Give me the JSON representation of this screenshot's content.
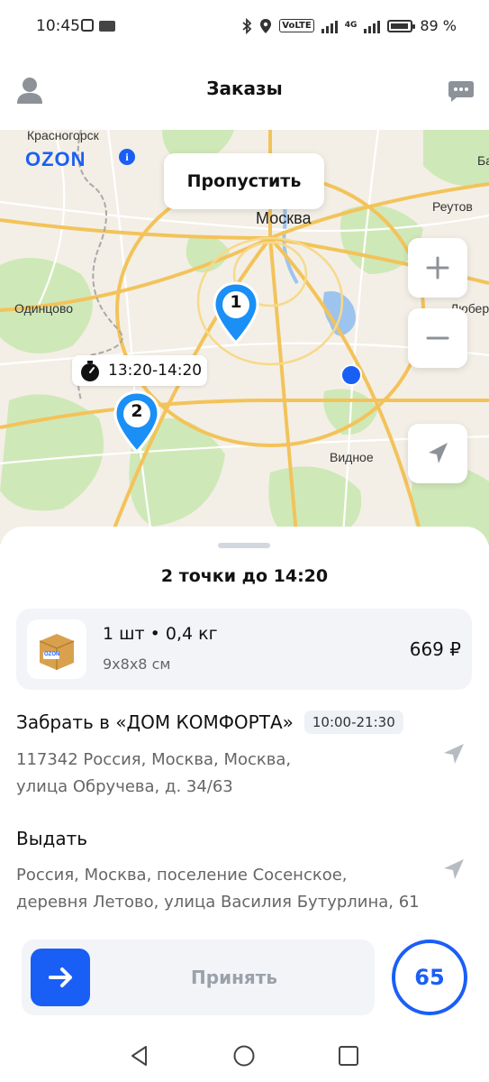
{
  "status_bar": {
    "time": "10:45",
    "network": "VoLTE",
    "signal_label": "4G",
    "battery_percent": "89 %"
  },
  "header": {
    "title": "Заказы"
  },
  "map": {
    "brand": "OZON",
    "skip_label": "Пропустить",
    "labels": {
      "krasnogorsk": "Красногорск",
      "moskva": "Москва",
      "reutov": "Реутов",
      "odintsovo": "Одинцово",
      "lyuber": "Люберц",
      "vidnoe": "Видное",
      "edge_b": "Ба"
    },
    "time_window": "13:20-14:20",
    "pins": [
      {
        "label": "1"
      },
      {
        "label": "2"
      }
    ]
  },
  "sheet": {
    "title": "2 точки до 14:20",
    "parcel": {
      "brand": "OZON",
      "summary": "1 шт • 0,4 кг",
      "dimensions": "9x8x8 см",
      "price": "669 ₽"
    },
    "pickup": {
      "title": "Забрать в «ДОМ КОМФОРТА»",
      "hours": "10:00-21:30",
      "address_line1": "117342 Россия, Москва, Москва,",
      "address_line2": "улица Обручева, д. 34/63"
    },
    "dropoff": {
      "title": "Выдать",
      "address_line1": "Россия, Москва, поселение Сосенское,",
      "address_line2": "деревня Летово, улица Василия Бутурлина, 61"
    },
    "accept_label": "Принять",
    "timer_value": "65"
  },
  "colors": {
    "accent": "#1a5ff5",
    "map_bg": "#f3efe6",
    "park": "#cfe8b8",
    "road_major": "#f3c35a",
    "water": "#9cc4ee"
  }
}
